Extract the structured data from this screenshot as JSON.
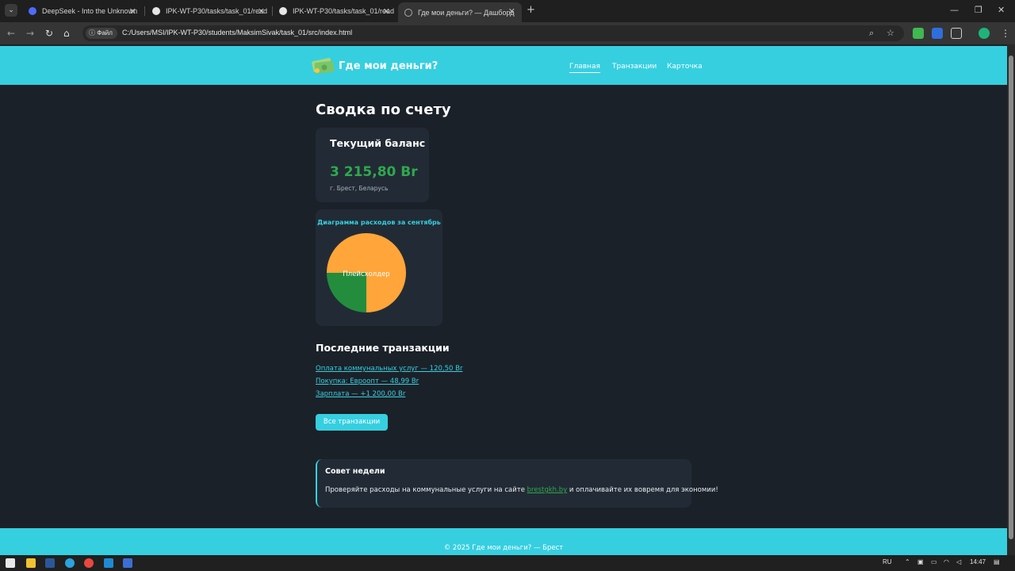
{
  "browser": {
    "tabs": [
      {
        "title": "DeepSeek - Into the Unknown",
        "favicon": "deepseek-icon",
        "active": false
      },
      {
        "title": "IPK-WT-P30/tasks/task_01/read",
        "favicon": "github-icon",
        "active": false
      },
      {
        "title": "IPK-WT-P30/tasks/task_01/read",
        "favicon": "github-icon",
        "active": false
      },
      {
        "title": "Где мои деньги? — Дашборд",
        "favicon": "globe-icon",
        "active": true
      }
    ],
    "new_tab": "+",
    "file_chip": "Файл",
    "url": "C:/Users/MSI/IPK-WT-P30/students/MaksimSivak/task_01/src/index.html"
  },
  "site": {
    "logo_text": "Где мои деньги?",
    "nav": [
      {
        "label": "Главная",
        "active": true
      },
      {
        "label": "Транзакции",
        "active": false
      },
      {
        "label": "Карточка",
        "active": false
      }
    ],
    "page_title": "Сводка по счету",
    "balance": {
      "title": "Текущий баланс",
      "value": "3 215,80 Br",
      "location": "г. Брест, Беларусь"
    },
    "chart_title": "Диаграмма расходов за сентябрь",
    "recent_title": "Последние транзакции",
    "transactions": [
      "Оплата коммунальных услуг — 120,50 Br",
      "Покупка: Евроопт — 48,99 Br",
      "Зарплата — +1 200,00 Br"
    ],
    "all_tx_button": "Все транзакции",
    "tip": {
      "title": "Совет недели",
      "text_before": "Проверяйте расходы на коммунальные услуги на сайте ",
      "link": "brestgkh.by",
      "text_after": " и оплачивайте их вовремя для экономии!"
    },
    "footer": "© 2025 Где мои деньги? — Брест"
  },
  "chart_data": {
    "type": "pie",
    "title": "Диаграмма расходов за сентябрь",
    "center_label": "Плейсхолдер",
    "slices": [
      {
        "value": 75,
        "color": "#ffa53a"
      },
      {
        "value": 25,
        "color": "#238d3d"
      }
    ]
  },
  "taskbar": {
    "lang": "RU",
    "time": "14:47"
  },
  "colors": {
    "accent": "#36cfe0",
    "page_bg": "#1b2129",
    "card_bg": "#222b35",
    "balance_green": "#2fa84f"
  }
}
